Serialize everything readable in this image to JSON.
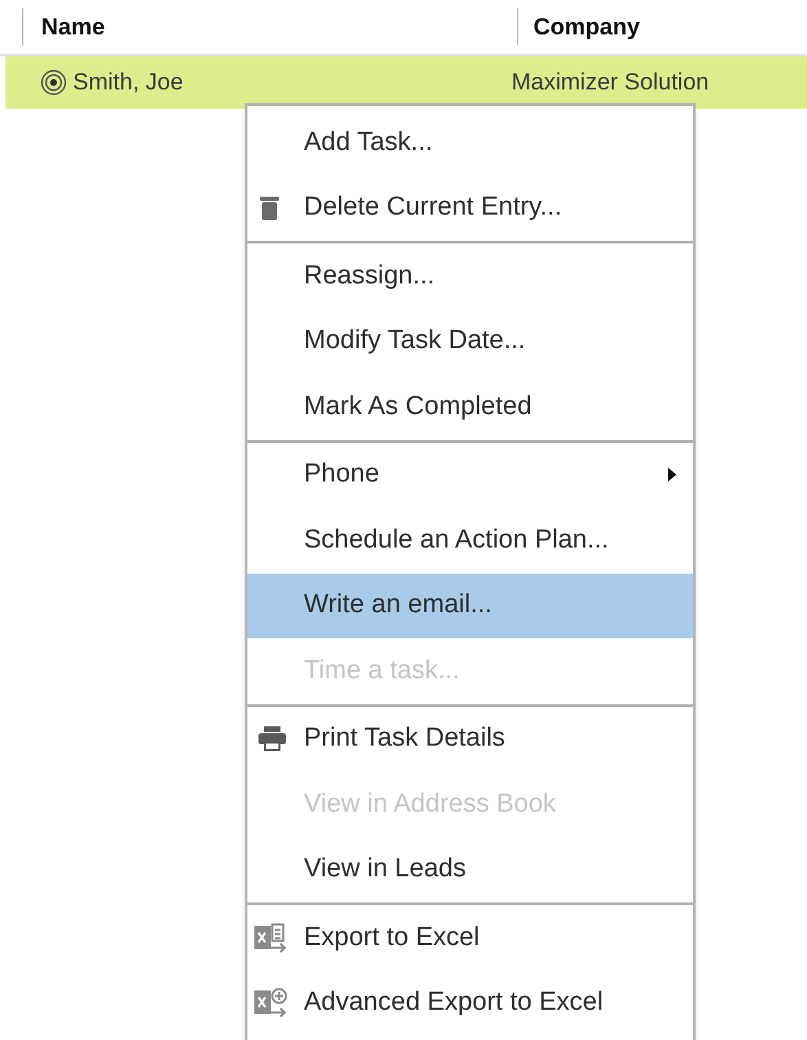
{
  "table": {
    "columns": [
      "Name",
      "Company"
    ],
    "rows": [
      {
        "name": "Smith, Joe",
        "company": "Maximizer Solution",
        "selected": true
      }
    ]
  },
  "context_menu": {
    "groups": [
      [
        {
          "label": "Add Task...",
          "kind": "text",
          "disabled": false,
          "selected": false
        },
        {
          "label": "Delete Current Entry...",
          "kind": "delete",
          "disabled": false,
          "selected": false
        }
      ],
      [
        {
          "label": "Reassign...",
          "kind": "text",
          "disabled": false,
          "selected": false
        },
        {
          "label": "Modify Task Date...",
          "kind": "text",
          "disabled": false,
          "selected": false
        },
        {
          "label": "Mark As Completed",
          "kind": "text",
          "disabled": false,
          "selected": false
        }
      ],
      [
        {
          "label": "Phone",
          "kind": "submenu",
          "disabled": false,
          "selected": false
        },
        {
          "label": "Schedule an Action Plan...",
          "kind": "text",
          "disabled": false,
          "selected": false
        },
        {
          "label": "Write an email...",
          "kind": "text",
          "disabled": false,
          "selected": true
        },
        {
          "label": "Time a task...",
          "kind": "text",
          "disabled": true,
          "selected": false
        }
      ],
      [
        {
          "label": "Print Task Details",
          "kind": "print",
          "disabled": false,
          "selected": false
        },
        {
          "label": "View in Address Book",
          "kind": "text",
          "disabled": true,
          "selected": false
        },
        {
          "label": "View in Leads",
          "kind": "text",
          "disabled": false,
          "selected": false
        }
      ],
      [
        {
          "label": "Export to Excel",
          "kind": "export",
          "disabled": false,
          "selected": false
        },
        {
          "label": "Advanced Export to Excel",
          "kind": "advanced-export",
          "disabled": false,
          "selected": false
        }
      ]
    ]
  }
}
